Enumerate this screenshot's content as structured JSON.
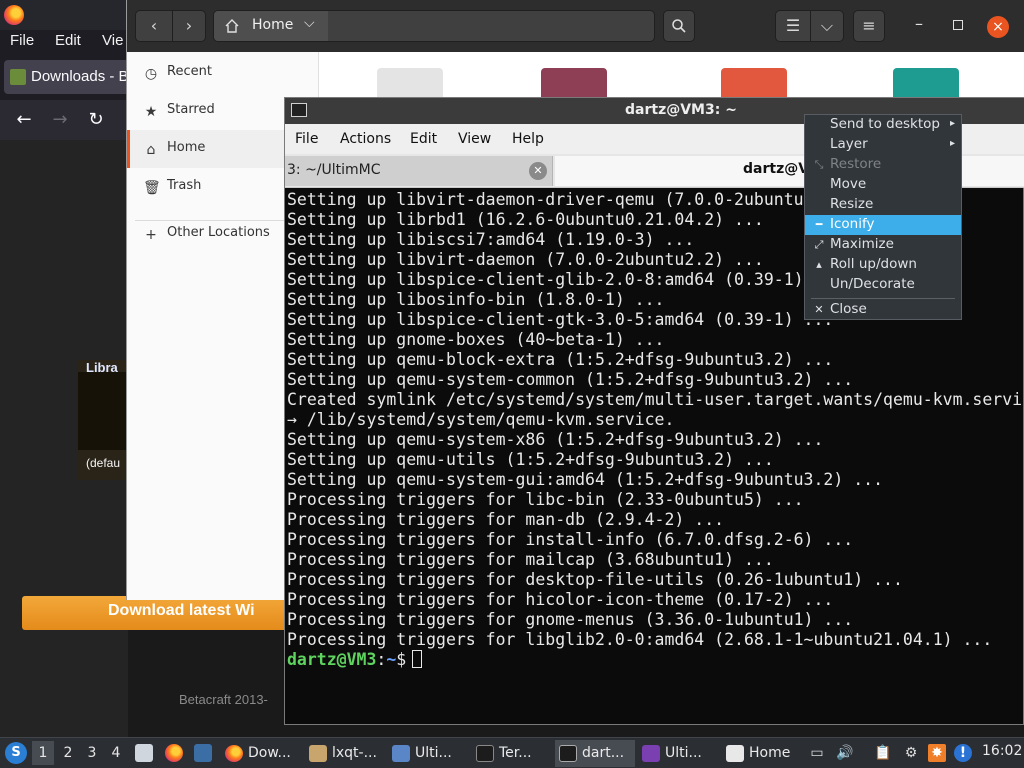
{
  "colors": {
    "accent": "#e95420",
    "menu_highlight": "#3daee9",
    "terminal_bg": "#0b0b0b",
    "prompt_user": "#5fd35f",
    "prompt_path": "#6aa0ff"
  },
  "firefox": {
    "menu": [
      "File",
      "Edit",
      "Vie"
    ],
    "tab_title": "Downloads - B",
    "page": {
      "panel_title": "Libra",
      "panel_default": "(defau",
      "download_button": "Download latest Wi",
      "footer": "Betacraft 2013-"
    }
  },
  "file_manager": {
    "path_label": "Home",
    "sidebar": [
      {
        "label": "Recent",
        "icon": "clock-icon"
      },
      {
        "label": "Starred",
        "icon": "star-icon"
      },
      {
        "label": "Home",
        "icon": "home-icon",
        "active": true
      },
      {
        "label": "Trash",
        "icon": "trash-icon"
      },
      {
        "label": "Other Locations",
        "icon": "plus-icon"
      }
    ]
  },
  "terminal": {
    "title": "dartz@VM3: ~",
    "menu": [
      "File",
      "Actions",
      "Edit",
      "View",
      "Help"
    ],
    "tabs": [
      {
        "label": "3: ~/UltimMC"
      },
      {
        "label": "dartz@V"
      }
    ],
    "lines": [
      "Setting up libvirt-daemon-driver-qemu (7.0.0-2ubuntu",
      "Setting up librbd1 (16.2.6-0ubuntu0.21.04.2) ...",
      "Setting up libiscsi7:amd64 (1.19.0-3) ...",
      "Setting up libvirt-daemon (7.0.0-2ubuntu2.2) ...",
      "Setting up libspice-client-glib-2.0-8:amd64 (0.39-1)",
      "Setting up libosinfo-bin (1.8.0-1) ...",
      "Setting up libspice-client-gtk-3.0-5:amd64 (0.39-1) ...",
      "Setting up gnome-boxes (40~beta-1) ...",
      "Setting up qemu-block-extra (1:5.2+dfsg-9ubuntu3.2) ...",
      "Setting up qemu-system-common (1:5.2+dfsg-9ubuntu3.2) ...",
      "Created symlink /etc/systemd/system/multi-user.target.wants/qemu-kvm.servi",
      "→ /lib/systemd/system/qemu-kvm.service.",
      "Setting up qemu-system-x86 (1:5.2+dfsg-9ubuntu3.2) ...",
      "Setting up qemu-utils (1:5.2+dfsg-9ubuntu3.2) ...",
      "Setting up qemu-system-gui:amd64 (1:5.2+dfsg-9ubuntu3.2) ...",
      "Processing triggers for libc-bin (2.33-0ubuntu5) ...",
      "Processing triggers for man-db (2.9.4-2) ...",
      "Processing triggers for install-info (6.7.0.dfsg.2-6) ...",
      "Processing triggers for mailcap (3.68ubuntu1) ...",
      "Processing triggers for desktop-file-utils (0.26-1ubuntu1) ...",
      "Processing triggers for hicolor-icon-theme (0.17-2) ...",
      "Processing triggers for gnome-menus (3.36.0-1ubuntu1) ...",
      "Processing triggers for libglib2.0-0:amd64 (2.68.1-1~ubuntu21.04.1) ..."
    ],
    "prompt": {
      "user_host": "dartz@VM3",
      "sep": ":",
      "path": "~",
      "symbol": "$"
    }
  },
  "context_menu": {
    "items": [
      {
        "label": "Send to desktop",
        "submenu": true
      },
      {
        "label": "Layer",
        "submenu": true
      },
      {
        "label": "Restore",
        "disabled": true,
        "icon": "restore-icon"
      },
      {
        "label": "Move"
      },
      {
        "label": "Resize"
      },
      {
        "label": "Iconify",
        "highlighted": true,
        "icon": "minimize-icon"
      },
      {
        "label": "Maximize",
        "icon": "maximize-icon"
      },
      {
        "label": "Roll up/down",
        "icon": "rollup-icon"
      },
      {
        "label": "Un/Decorate"
      },
      {
        "label": "Close",
        "icon": "close-icon"
      }
    ]
  },
  "taskbar": {
    "desktops": [
      "1",
      "2",
      "3",
      "4"
    ],
    "tasks": [
      {
        "label": "Dow..."
      },
      {
        "label": "lxqt-..."
      },
      {
        "label": "Ulti..."
      },
      {
        "label": "Ter..."
      },
      {
        "label": "dart..."
      },
      {
        "label": "Ulti..."
      },
      {
        "label": "Home"
      }
    ],
    "clock": "16:02"
  }
}
